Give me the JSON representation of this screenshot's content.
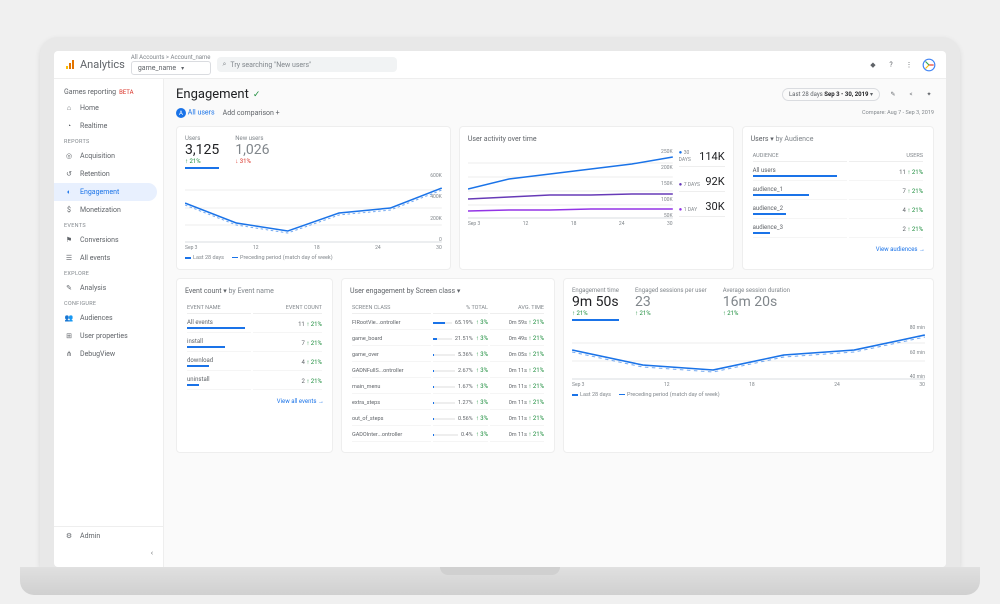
{
  "header": {
    "product": "Analytics",
    "crumb": "All Accounts > Account_name",
    "property": "game_name",
    "search_placeholder": "Try searching \"New users\""
  },
  "sidebar": {
    "section_head": "Games reporting",
    "beta": "BETA",
    "items": [
      {
        "label": "Home",
        "icon": "home"
      },
      {
        "label": "Realtime",
        "icon": "clock"
      }
    ],
    "reports_label": "REPORTS",
    "reports": [
      {
        "label": "Acquisition",
        "icon": "target"
      },
      {
        "label": "Retention",
        "icon": "retention"
      },
      {
        "label": "Engagement",
        "icon": "engage",
        "active": true
      },
      {
        "label": "Monetization",
        "icon": "money"
      }
    ],
    "events_label": "EVENTS",
    "events": [
      {
        "label": "Conversions",
        "icon": "flag"
      },
      {
        "label": "All events",
        "icon": "list"
      }
    ],
    "explore_label": "EXPLORE",
    "explore": [
      {
        "label": "Analysis",
        "icon": "analysis"
      }
    ],
    "configure_label": "CONFIGURE",
    "configure": [
      {
        "label": "Audiences",
        "icon": "people"
      },
      {
        "label": "User properties",
        "icon": "props"
      },
      {
        "label": "DebugView",
        "icon": "debug"
      }
    ],
    "admin": "Admin"
  },
  "page": {
    "title": "Engagement",
    "all_users": "All users",
    "add_comparison": "Add comparison",
    "date_label": "Last 28 days",
    "date_range": "Sep 3 - 30, 2019",
    "compare": "Compare: Aug 7 - Sep 3, 2019"
  },
  "card_users": {
    "users_label": "Users",
    "users_val": "3,125",
    "users_delta": "↑ 21%",
    "new_label": "New users",
    "new_val": "1,026",
    "new_delta": "↓ 31%",
    "ylabels": [
      "600K",
      "400K",
      "200K",
      "0"
    ],
    "xlabels": [
      "Sep 3",
      "12",
      "18",
      "24",
      "30"
    ],
    "legend_a": "Last 28 days",
    "legend_b": "Preceding period (match day of week)"
  },
  "card_activity": {
    "title": "User activity over time",
    "ylabels": [
      "250K",
      "200K",
      "150K",
      "100K",
      "50K"
    ],
    "xlabels": [
      "Sep 3",
      "12",
      "18",
      "24",
      "30"
    ],
    "stats": [
      {
        "label": "30 DAYS",
        "val": "114K",
        "color": "#1a73e8"
      },
      {
        "label": "7 DAYS",
        "val": "92K",
        "color": "#673ab7"
      },
      {
        "label": "1 DAY",
        "val": "30K",
        "color": "#9334e6"
      }
    ]
  },
  "card_audience": {
    "title": "Users",
    "by": "by Audience",
    "head_a": "AUDIENCE",
    "head_b": "USERS",
    "rows": [
      {
        "name": "All users",
        "val": "11",
        "delta": "↑ 21%"
      },
      {
        "name": "audience_1",
        "val": "7",
        "delta": "↑ 21%"
      },
      {
        "name": "audience_2",
        "val": "4",
        "delta": "↑ 21%"
      },
      {
        "name": "audience_3",
        "val": "2",
        "delta": "↑ 21%"
      }
    ],
    "link": "View audiences"
  },
  "card_events": {
    "title": "Event count",
    "by": "by Event name",
    "head_a": "EVENT NAME",
    "head_b": "EVENT COUNT",
    "rows": [
      {
        "name": "All events",
        "val": "11",
        "delta": "↑ 21%"
      },
      {
        "name": "install",
        "val": "7",
        "delta": "↑ 21%"
      },
      {
        "name": "download",
        "val": "4",
        "delta": "↑ 21%"
      },
      {
        "name": "uninstall",
        "val": "2",
        "delta": "↑ 21%"
      }
    ],
    "link": "View all events"
  },
  "card_screens": {
    "title": "User engagement  by Screen class",
    "head_a": "SCREEN CLASS",
    "head_b": "% TOTAL",
    "head_c": "AVG. TIME",
    "rows": [
      {
        "name": "FIRootVie...ontroller",
        "pct": "65.19%",
        "pctd": "↑ 3%",
        "w": 65,
        "time": "0m 59s",
        "td": "↑ 21%"
      },
      {
        "name": "game_board",
        "pct": "21.51%",
        "pctd": "↑ 3%",
        "w": 22,
        "time": "0m 49s",
        "td": "↑ 21%"
      },
      {
        "name": "game_over",
        "pct": "5.36%",
        "pctd": "↑ 3%",
        "w": 5,
        "time": "0m 05s",
        "td": "↑ 21%"
      },
      {
        "name": "GADNFullS...ontroller",
        "pct": "2.67%",
        "pctd": "↑ 3%",
        "w": 3,
        "time": "0m 11s",
        "td": "↑ 21%"
      },
      {
        "name": "main_menu",
        "pct": "1.67%",
        "pctd": "↑ 3%",
        "w": 2,
        "time": "0m 11s",
        "td": "↑ 21%"
      },
      {
        "name": "extra_steps",
        "pct": "1.27%",
        "pctd": "↑ 3%",
        "w": 1,
        "time": "0m 11s",
        "td": "↑ 21%"
      },
      {
        "name": "out_of_steps",
        "pct": "0.56%",
        "pctd": "↑ 3%",
        "w": 1,
        "time": "0m 11s",
        "td": "↑ 21%"
      },
      {
        "name": "GADOInter...ontroller",
        "pct": "0.4%",
        "pctd": "↑ 3%",
        "w": 1,
        "time": "0m 11s",
        "td": "↑ 21%"
      }
    ]
  },
  "card_engtime": {
    "m1_label": "Engagement time",
    "m1_val": "9m 50s",
    "m1_delta": "↑ 21%",
    "m2_label": "Engaged sessions per user",
    "m2_val": "23",
    "m2_delta": "↑ 21%",
    "m3_label": "Average session duration",
    "m3_val": "16m 20s",
    "m3_delta": "↑ 21%",
    "ylabels": [
      "80 min",
      "60 min",
      "40 min"
    ],
    "xlabels": [
      "Sep 3",
      "12",
      "18",
      "24",
      "30"
    ],
    "legend_a": "Last 28 days",
    "legend_b": "Preceding period (match day of week)"
  },
  "chart_data": [
    {
      "type": "line",
      "title": "Users",
      "x": [
        "Sep 3",
        "12",
        "18",
        "24",
        "30"
      ],
      "series": [
        {
          "name": "Last 28 days",
          "values": [
            300,
            150,
            100,
            200,
            250,
            450
          ]
        },
        {
          "name": "Preceding period",
          "values": [
            310,
            160,
            110,
            210,
            260,
            460
          ]
        }
      ],
      "ylim": [
        0,
        600
      ],
      "ylabel": "K"
    },
    {
      "type": "line",
      "title": "User activity over time",
      "x": [
        "Sep 3",
        "12",
        "18",
        "24",
        "30"
      ],
      "series": [
        {
          "name": "30 days",
          "values": [
            120,
            150,
            170,
            190,
            210,
            230
          ]
        },
        {
          "name": "7 days",
          "values": [
            80,
            85,
            90,
            90,
            92,
            92
          ]
        },
        {
          "name": "1 day",
          "values": [
            25,
            28,
            28,
            30,
            30,
            30
          ]
        }
      ],
      "ylim": [
        50,
        250
      ],
      "ylabel": "K"
    },
    {
      "type": "line",
      "title": "Engagement time",
      "x": [
        "Sep 3",
        "12",
        "18",
        "24",
        "30"
      ],
      "series": [
        {
          "name": "Last 28 days",
          "values": [
            60,
            45,
            40,
            55,
            60,
            75
          ]
        },
        {
          "name": "Preceding period",
          "values": [
            62,
            47,
            42,
            57,
            62,
            77
          ]
        }
      ],
      "ylim": [
        40,
        80
      ],
      "ylabel": "min"
    }
  ]
}
